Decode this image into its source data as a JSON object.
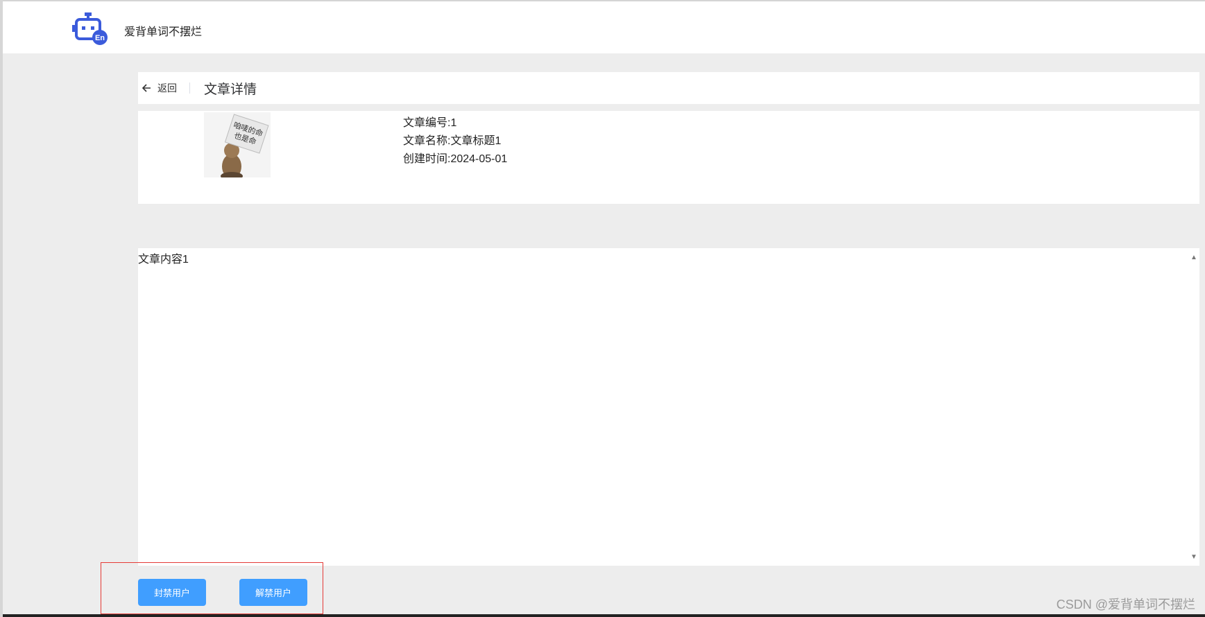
{
  "app": {
    "brand_name": "爱背单词不摆烂"
  },
  "header": {
    "back_label": "返回",
    "title": "文章详情"
  },
  "article": {
    "id_line": "文章编号:1",
    "name_line": "文章名称:文章标题1",
    "created_line": "创建时间:2024-05-01",
    "cover_sign_line1": "咱唛的命",
    "cover_sign_line2": "也是命",
    "content": "文章内容1"
  },
  "actions": {
    "ban_label": "封禁用户",
    "unban_label": "解禁用户"
  },
  "watermark": "CSDN @爱背单词不摆烂",
  "colors": {
    "primary": "#409eff",
    "logo": "#3b5bdb",
    "highlight": "#e53935"
  }
}
